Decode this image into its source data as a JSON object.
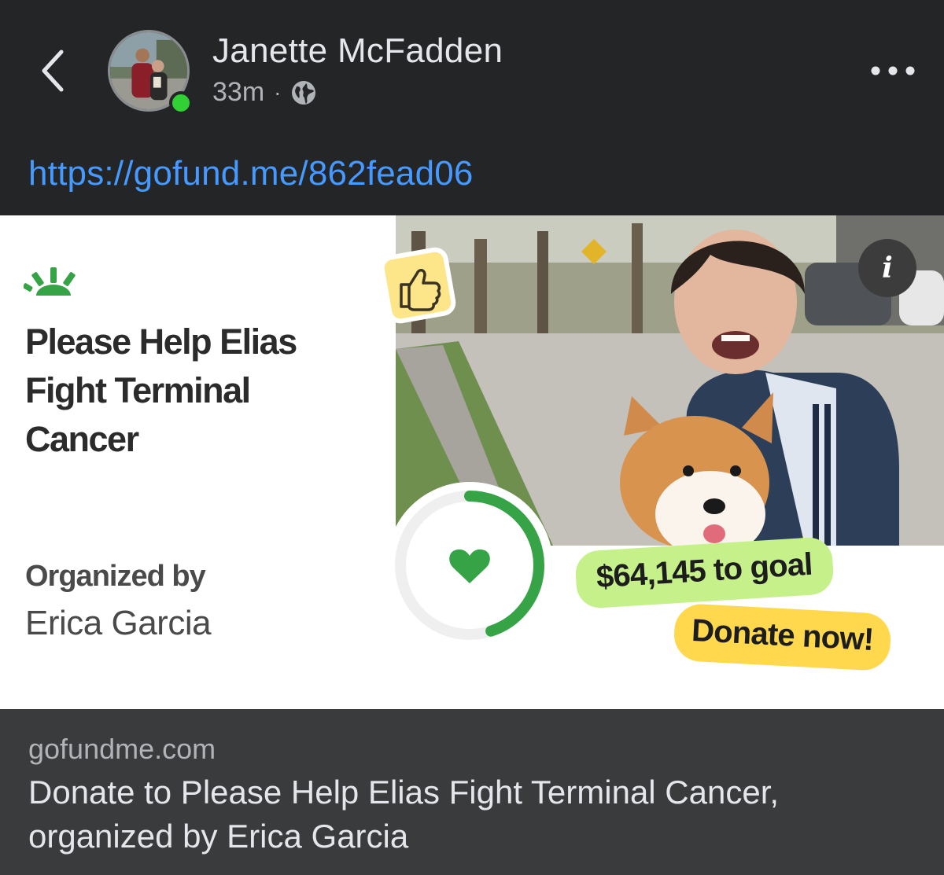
{
  "post": {
    "author_name": "Janette McFadden",
    "time": "33m",
    "separator": "·",
    "visibility_icon": "globe-icon",
    "link_text": "https://gofund.me/862fead06"
  },
  "preview": {
    "campaign_title": "Please Help Elias Fight Terminal Cancer",
    "organized_label": "Organized by",
    "organizer_name": "Erica Garcia",
    "info_label": "i",
    "goal_text": "$64,145 to goal",
    "donate_label": "Donate now!",
    "progress_fraction": 0.45,
    "colors": {
      "green": "#37a347",
      "goal_bg": "#c5f08a",
      "donate_bg": "#ffd84d",
      "badge_bg": "#fde68a"
    }
  },
  "link_card": {
    "domain": "gofundme.com",
    "title": "Donate to Please Help Elias Fight Terminal Cancer, organized by Erica Garcia"
  }
}
